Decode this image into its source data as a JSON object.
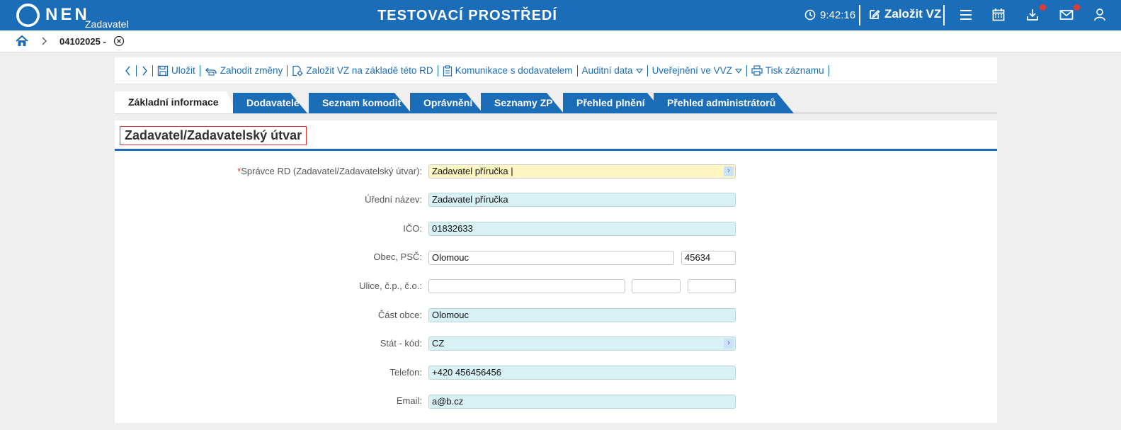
{
  "header": {
    "logo_text": "NEN",
    "logo_sub": "Zadavatel",
    "env_title": "TESTOVACÍ PROSTŘEDÍ",
    "time": "9:42:16",
    "create_label": "Založit VZ",
    "icons": [
      "clock-icon",
      "edit-icon",
      "menu-icon",
      "calendar-icon",
      "download-icon",
      "mail-icon",
      "user-icon"
    ],
    "accent_color": "#1b6db8"
  },
  "breadcrumb": {
    "record_id": "04102025 -"
  },
  "toolbar": {
    "save": "Uložit",
    "discard": "Zahodit změny",
    "create_from_rd": "Založit VZ na základě této RD",
    "communication": "Komunikace s dodavatelem",
    "audit": "Auditní data",
    "publish": "Uveřejnění ve VVZ",
    "print": "Tisk záznamu"
  },
  "tabs": [
    {
      "label": "Základní informace"
    },
    {
      "label": "Dodavatelé"
    },
    {
      "label": "Seznam komodit"
    },
    {
      "label": "Oprávnění"
    },
    {
      "label": "Seznamy ZP"
    },
    {
      "label": "Přehled plnění"
    },
    {
      "label": "Přehled administrátorů"
    }
  ],
  "section": {
    "title": "Zadavatel/Zadavatelský útvar"
  },
  "form": {
    "spravce_label": "Správce RD (Zadavatel/Zadavatelský útvar):",
    "spravce_value": "Zadavatel příručka |",
    "nazev_label": "Úřední název:",
    "nazev_value": "Zadavatel příručka",
    "ico_label": "IČO:",
    "ico_value": "01832633",
    "obec_label": "Obec, PSČ:",
    "obec_value": "Olomouc",
    "psc_value": "45634",
    "ulice_label": "Ulice, č.p., č.o.:",
    "ulice_value": "",
    "cp_value": "",
    "co_value": "",
    "cast_label": "Část obce:",
    "cast_value": "Olomouc",
    "stat_label": "Stát - kód:",
    "stat_value": "CZ",
    "telefon_label": "Telefon:",
    "telefon_value": "+420 456456456",
    "email_label": "Email:",
    "email_value": "a@b.cz"
  }
}
